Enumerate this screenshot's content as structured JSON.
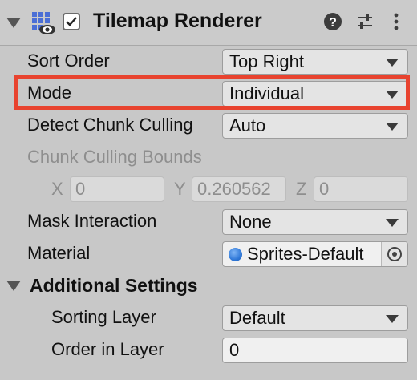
{
  "component": {
    "title": "Tilemap Renderer",
    "enabled": true,
    "icon": "tilemap-renderer-icon",
    "header_icons": [
      "help-icon",
      "presets-icon",
      "more-menu-icon"
    ]
  },
  "fields": {
    "sort_order": {
      "label": "Sort Order",
      "value": "Top Right"
    },
    "mode": {
      "label": "Mode",
      "value": "Individual"
    },
    "detect_chunk_culling": {
      "label": "Detect Chunk Culling",
      "value": "Auto"
    },
    "chunk_culling_bounds": {
      "label": "Chunk Culling Bounds",
      "x_label": "X",
      "x_value": "0",
      "y_label": "Y",
      "y_value": "0.260562",
      "z_label": "Z",
      "z_value": "0"
    },
    "mask_interaction": {
      "label": "Mask Interaction",
      "value": "None"
    },
    "material": {
      "label": "Material",
      "value": "Sprites-Default"
    }
  },
  "additional_settings": {
    "title": "Additional Settings",
    "sorting_layer": {
      "label": "Sorting Layer",
      "value": "Default"
    },
    "order_in_layer": {
      "label": "Order in Layer",
      "value": "0"
    }
  },
  "colors": {
    "highlight": "#e8432f",
    "background": "#c8c8c8"
  }
}
